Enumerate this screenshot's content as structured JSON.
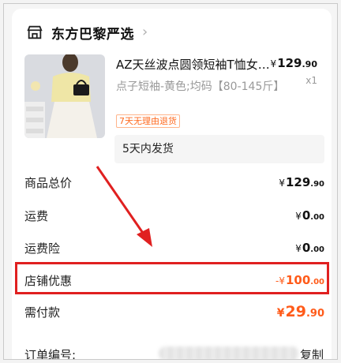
{
  "store": {
    "name": "东方巴黎严选",
    "icon": "store-icon",
    "chevron": "›"
  },
  "product": {
    "title": "AZ天丝波点圆领短袖T恤女…",
    "price_symbol": "¥",
    "price_int": "129",
    "price_dec": ".90",
    "quantity": "x1",
    "spec": "点子短袖-黄色;均码【80-145斤】",
    "return_badge": "7天无理由退货",
    "shipping": "5天内发货"
  },
  "summary": {
    "goods_total": {
      "label": "商品总价",
      "symbol": "¥",
      "int": "129",
      "dec": ".90"
    },
    "shipping_fee": {
      "label": "运费",
      "symbol": "¥",
      "int": "0",
      "dec": ".00"
    },
    "shipping_insurance": {
      "label": "运费险",
      "symbol": "¥",
      "int": "0",
      "dec": ".00"
    },
    "store_discount": {
      "label": "店铺优惠",
      "symbol": "-¥",
      "int": "100",
      "dec": ".00"
    },
    "amount_due": {
      "label": "需付款",
      "symbol": "¥",
      "int": "29",
      "dec": ".90"
    }
  },
  "order": {
    "label": "订单编号:",
    "copy_label": "复制"
  },
  "colors": {
    "accent": "#ff5b1a",
    "annotation": "#e02020",
    "badge": "#ff6a1f"
  }
}
